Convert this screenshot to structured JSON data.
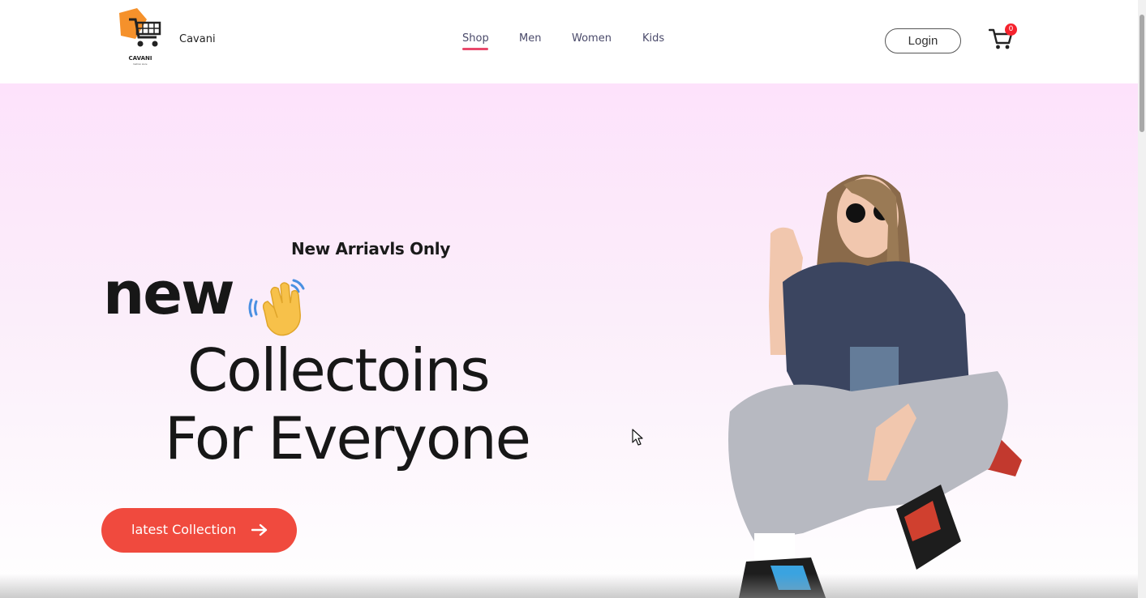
{
  "navbar": {
    "logo_caption": "CAVANI",
    "logo_subcaption": "fashion store",
    "brand": "Cavani",
    "links": [
      {
        "label": "Shop",
        "active": true
      },
      {
        "label": "Men"
      },
      {
        "label": "Women"
      },
      {
        "label": "Kids"
      }
    ],
    "login_label": "Login",
    "cart_count": "0",
    "accent_color": "#e9496b"
  },
  "hero": {
    "tagline": "New Arriavls Only",
    "headline_line1": "new",
    "headline_line2": "Collectoins",
    "headline_line3": "For Everyone",
    "cta_label": "latest Collection",
    "cta_color": "#f04a3e",
    "icons": [
      "waving-hand-icon",
      "arrow-right-icon",
      "cart-icon"
    ]
  }
}
